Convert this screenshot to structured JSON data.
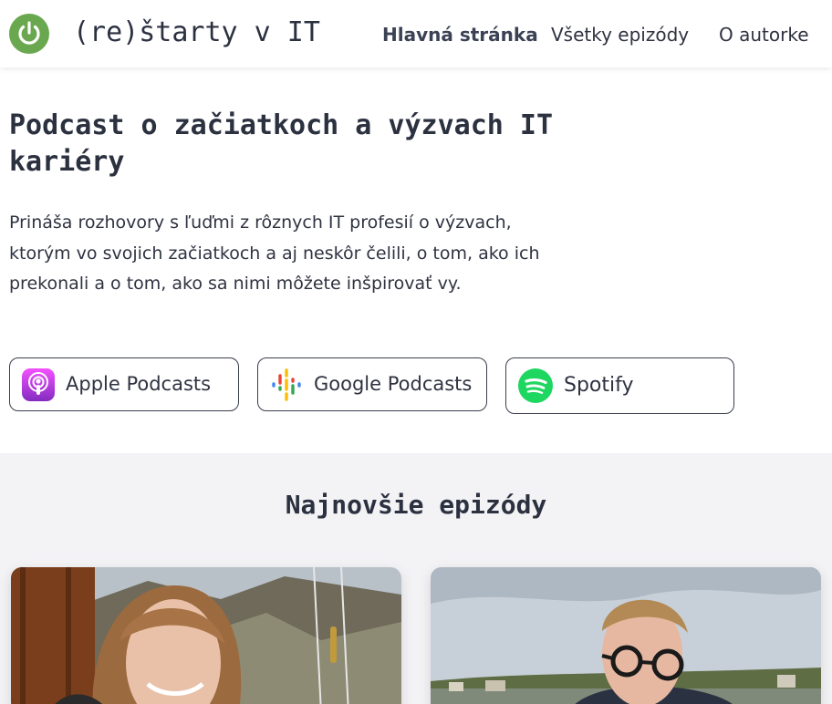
{
  "header": {
    "brand": "(re)štarty v IT",
    "logo_icon": "power-icon",
    "nav": [
      {
        "label": "Hlavná stránka",
        "active": true
      },
      {
        "label": "Všetky epizódy",
        "active": false
      },
      {
        "label": "O autorke",
        "active": false
      }
    ]
  },
  "hero": {
    "title": "Podcast o začiatkoch a výzvach IT kariéry",
    "description": "Prináša rozhovory s ľuďmi z rôznych IT profesií o výzvach, ktorým vo svojich začiatkoch a aj neskôr čelili, o tom, ako ich prekonali a o tom, ako sa nimi môžete inšpirovať vy."
  },
  "platforms": [
    {
      "label": "Apple Podcasts",
      "icon": "apple-podcasts-icon"
    },
    {
      "label": "Google Podcasts",
      "icon": "google-podcasts-icon"
    },
    {
      "label": "Spotify",
      "icon": "spotify-icon"
    }
  ],
  "episodes_section": {
    "title": "Najnovšie epizódy"
  },
  "colors": {
    "logo_green": "#6aa84f",
    "text_dark": "#2c3140",
    "section_bg": "#f3f3f6",
    "spotify_green": "#1ed760",
    "apple_purple": "#a24ee0"
  }
}
